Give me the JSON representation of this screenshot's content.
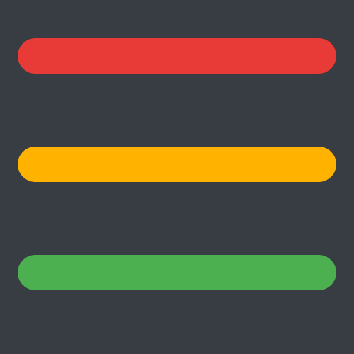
{
  "icon": {
    "name": "hamburger-menu-icon",
    "background_color": "#383d43",
    "bars": [
      {
        "id": "top",
        "color": "#e83a37"
      },
      {
        "id": "middle",
        "color": "#ffb300"
      },
      {
        "id": "bottom",
        "color": "#4caf50"
      }
    ]
  }
}
